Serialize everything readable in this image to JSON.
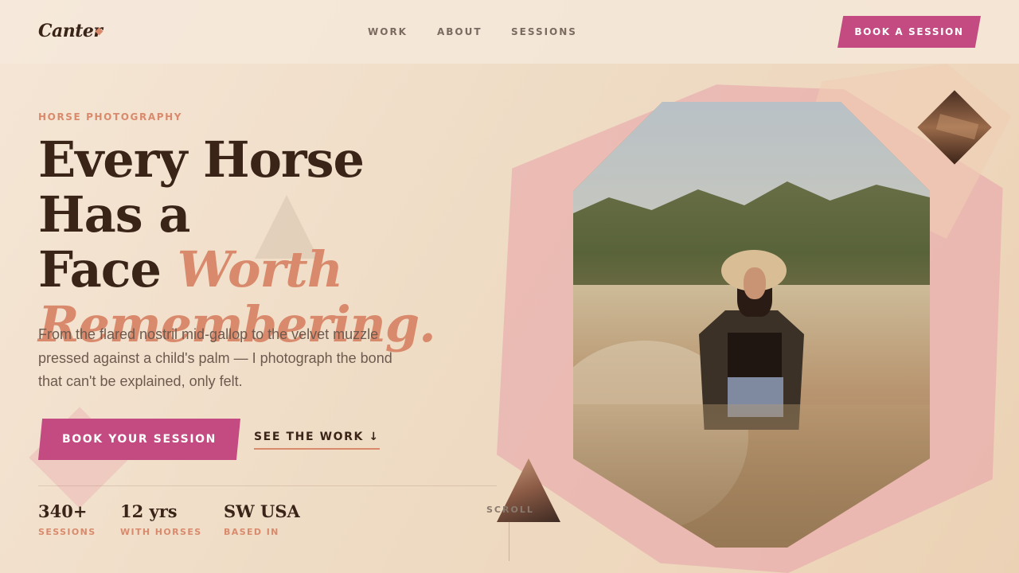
{
  "nav": {
    "logo": "Canter",
    "links": [
      "WORK",
      "ABOUT",
      "SESSIONS"
    ],
    "cta": "BOOK A SESSION"
  },
  "hero": {
    "eyebrow": "HORSE PHOTOGRAPHY",
    "headline_line1": "Every Horse Has a",
    "headline_plain": "Face ",
    "headline_accent_1": "Worth",
    "headline_accent_2": "Remembering.",
    "lead": "From the flared nostril mid-gallop to the velvet muzzle pressed against a child's palm — I photograph the bond that can't be explained, only felt.",
    "primary_cta": "BOOK YOUR SESSION",
    "secondary_cta": "SEE THE WORK ↓"
  },
  "stats": [
    {
      "value": "340+",
      "label": "SESSIONS"
    },
    {
      "value": "12 yrs",
      "label": "WITH HORSES"
    },
    {
      "value": "SW USA",
      "label": "BASED IN"
    }
  ],
  "scroll_label": "SCROLL",
  "colors": {
    "accent_pink": "#c44a82",
    "accent_terracotta": "#d98a6c",
    "text_dark": "#3a2418",
    "background": "#f1e0cc"
  }
}
